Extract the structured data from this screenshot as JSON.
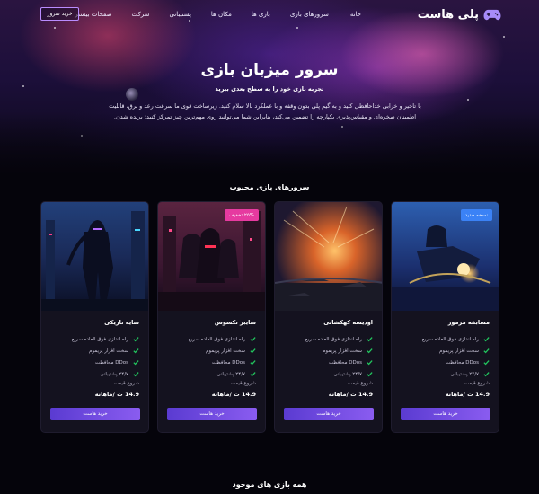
{
  "nav": {
    "logo_text": "پلی هاست",
    "links": [
      "خانه",
      "سرورهای بازی",
      "بازی ها",
      "مکان ها",
      "پشتیبانی",
      "شرکت",
      "صفحات بیشتر"
    ],
    "buy_label": "خرید سرور"
  },
  "hero": {
    "title": "سرور میزبان بازی",
    "subtitle": "تجربه بازی خود را به سطح بعدی ببرید",
    "description": "با تاخیر و خرابی خداحافظی کنید و به گیم پلی بدون وقفه و با عملکرد بالا سلام کنید. زیرساخت قوی ما سرعت رعد و برق، قابلیت اطمینان صخره‌ای و مقیاس‌پذیری یکپارچه را تضمین می‌کند، بنابراین شما می‌توانید روی مهم‌ترین چیز تمرکز کنید: برنده شدن."
  },
  "popular": {
    "title": "سرورهای بازی محبوب",
    "cards": [
      {
        "name": "مسابقه مرموز",
        "badge": "نسخه جدید",
        "badge_color": "#3b82f6",
        "features": [
          "راه اندازی فوق العاده سریع",
          "سخت افزار پریموم",
          "DDos محافظت",
          "۲۴/۷ پشتیبانی"
        ],
        "price_label": "شروع قیمت",
        "price": "14.9 ت /ماهانه",
        "button": "خرید هاست"
      },
      {
        "name": "اودیسه کهکشانی",
        "badge": "",
        "badge_color": "",
        "features": [
          "راه اندازی فوق العاده سریع",
          "سخت افزار پریموم",
          "DDos محافظت",
          "۲۴/۷ پشتیبانی"
        ],
        "price_label": "شروع قیمت",
        "price": "14.9 ت /ماهانه",
        "button": "خرید هاست"
      },
      {
        "name": "سایبر نکسوس",
        "badge": "۲۵% تخفیف",
        "badge_color": "#e63aa0",
        "features": [
          "راه اندازی فوق العاده سریع",
          "سخت افزار پریموم",
          "DDos محافظت",
          "۲۴/۷ پشتیبانی"
        ],
        "price_label": "شروع قیمت",
        "price": "14.9 ت /ماهانه",
        "button": "خرید هاست"
      },
      {
        "name": "سایه تاریکی",
        "badge": "",
        "badge_color": "",
        "features": [
          "راه اندازی فوق العاده سریع",
          "سخت افزار پریموم",
          "DDos محافظت",
          "۲۴/۷ پشتیبانی"
        ],
        "price_label": "شروع قیمت",
        "price": "14.9 ت /ماهانه",
        "button": "خرید هاست"
      }
    ]
  },
  "all_games": {
    "title": "همه بازی های موجود"
  },
  "colors": {
    "accent": "#7c4dff",
    "check": "#22c55e",
    "card_bg": "#14121f"
  }
}
